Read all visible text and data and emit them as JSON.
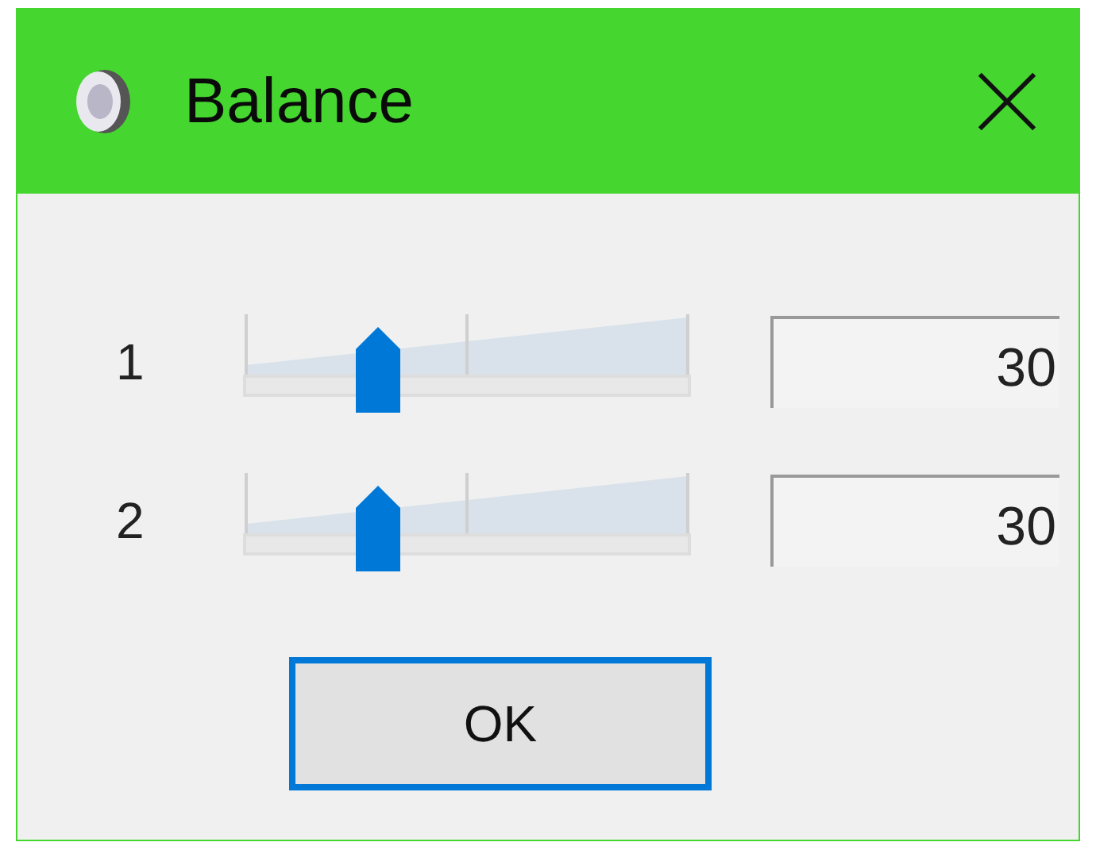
{
  "window": {
    "title": "Balance"
  },
  "channels": [
    {
      "label": "1",
      "level": 0.3,
      "value": "30"
    },
    {
      "label": "2",
      "level": 0.3,
      "value": "30"
    }
  ],
  "buttons": [
    {
      "label": "OK",
      "focused": true
    }
  ]
}
